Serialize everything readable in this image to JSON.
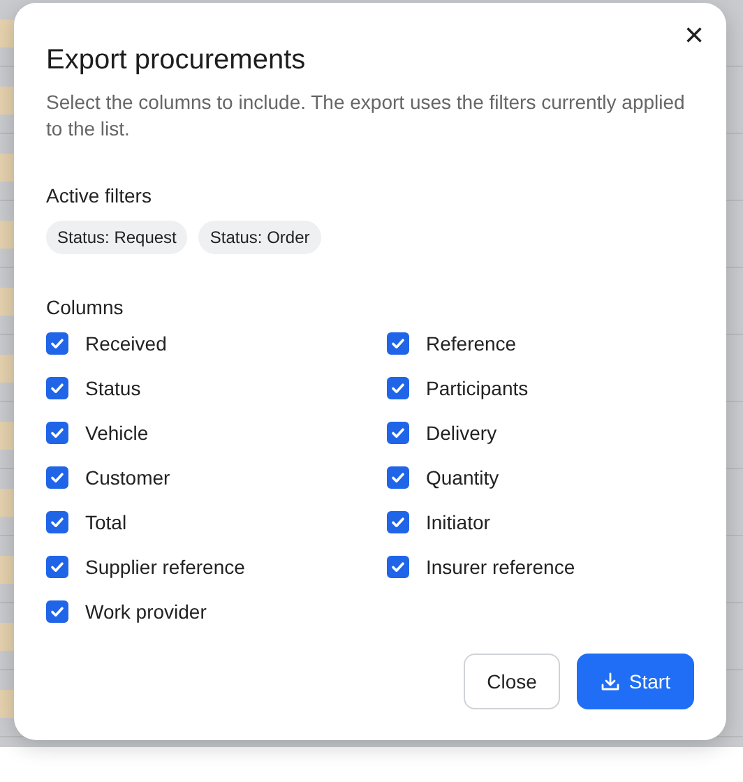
{
  "dialog": {
    "title": "Export procurements",
    "close_icon": "×",
    "description": "Select the columns to include. The export uses the filters currently applied to the list.",
    "filters_heading": "Active filters",
    "filters": [
      "Status: Request",
      "Status: Order"
    ],
    "columns_heading": "Columns",
    "columns": [
      {
        "label": "Received",
        "checked": true
      },
      {
        "label": "Reference",
        "checked": true
      },
      {
        "label": "Status",
        "checked": true
      },
      {
        "label": "Participants",
        "checked": true
      },
      {
        "label": "Vehicle",
        "checked": true
      },
      {
        "label": "Delivery",
        "checked": true
      },
      {
        "label": "Customer",
        "checked": true
      },
      {
        "label": "Quantity",
        "checked": true
      },
      {
        "label": "Total",
        "checked": true
      },
      {
        "label": "Initiator",
        "checked": true
      },
      {
        "label": "Supplier reference",
        "checked": true
      },
      {
        "label": "Insurer reference",
        "checked": true
      },
      {
        "label": "Work provider",
        "checked": true
      }
    ],
    "buttons": [
      {
        "label": "Close",
        "kind": "secondary"
      },
      {
        "label": "Start",
        "kind": "primary"
      }
    ]
  }
}
